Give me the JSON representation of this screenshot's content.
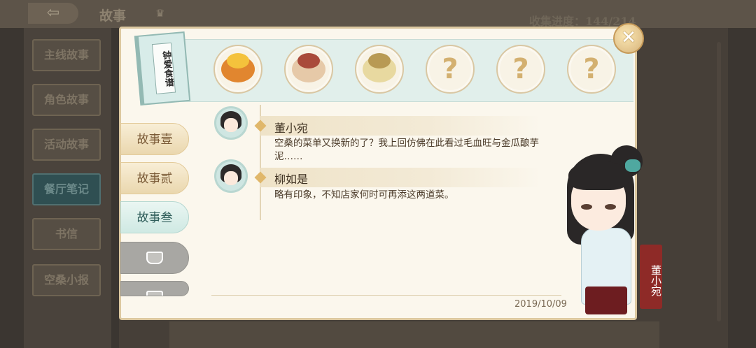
{
  "top_bar": {
    "back_icon": "back-arrow-icon",
    "title": "故事",
    "crown_icon": "crown-icon",
    "collection_progress": "收集进度：144/214"
  },
  "sidebar": {
    "items": [
      {
        "label": "主线故事",
        "active": false
      },
      {
        "label": "角色故事",
        "active": false
      },
      {
        "label": "活动故事",
        "active": false
      },
      {
        "label": "餐厅笔记",
        "active": true
      },
      {
        "label": "书信",
        "active": false
      },
      {
        "label": "空桑小报",
        "active": false
      }
    ]
  },
  "modal": {
    "close_icon": "close-x-icon",
    "recipe_book_title": "钟爱食谱",
    "recipes": [
      {
        "type": "dish",
        "icon": "dish-1-icon",
        "colors": [
          "#e1862f",
          "#f4c23c"
        ]
      },
      {
        "type": "dish",
        "icon": "dish-2-icon",
        "colors": [
          "#a94a3a",
          "#e6c9a8"
        ]
      },
      {
        "type": "dish",
        "icon": "dish-3-icon",
        "colors": [
          "#b89a54",
          "#e8d9a0"
        ]
      },
      {
        "type": "unknown",
        "label": "?"
      },
      {
        "type": "unknown",
        "label": "?"
      },
      {
        "type": "unknown",
        "label": "?"
      }
    ],
    "story_tabs": [
      {
        "label": "故事壹",
        "state": "normal"
      },
      {
        "label": "故事贰",
        "state": "normal"
      },
      {
        "label": "故事叁",
        "state": "active"
      },
      {
        "label": "",
        "state": "locked"
      },
      {
        "label": "",
        "state": "locked"
      }
    ],
    "messages": [
      {
        "speaker": "董小宛",
        "text": "空桑的菜单又换新的了？我上回仿佛在此看过毛血旺与金瓜酿芋泥……"
      },
      {
        "speaker": "柳如是",
        "text": "略有印象，不知店家何时可再添这两道菜。"
      }
    ],
    "date": "2019/10/09",
    "character_name": "董小宛"
  },
  "colors": {
    "modal_bg": "#fbf7ed",
    "accent_gold": "#e0b76a",
    "accent_teal": "#cfe9e3",
    "tag_red": "#8e2a27"
  }
}
